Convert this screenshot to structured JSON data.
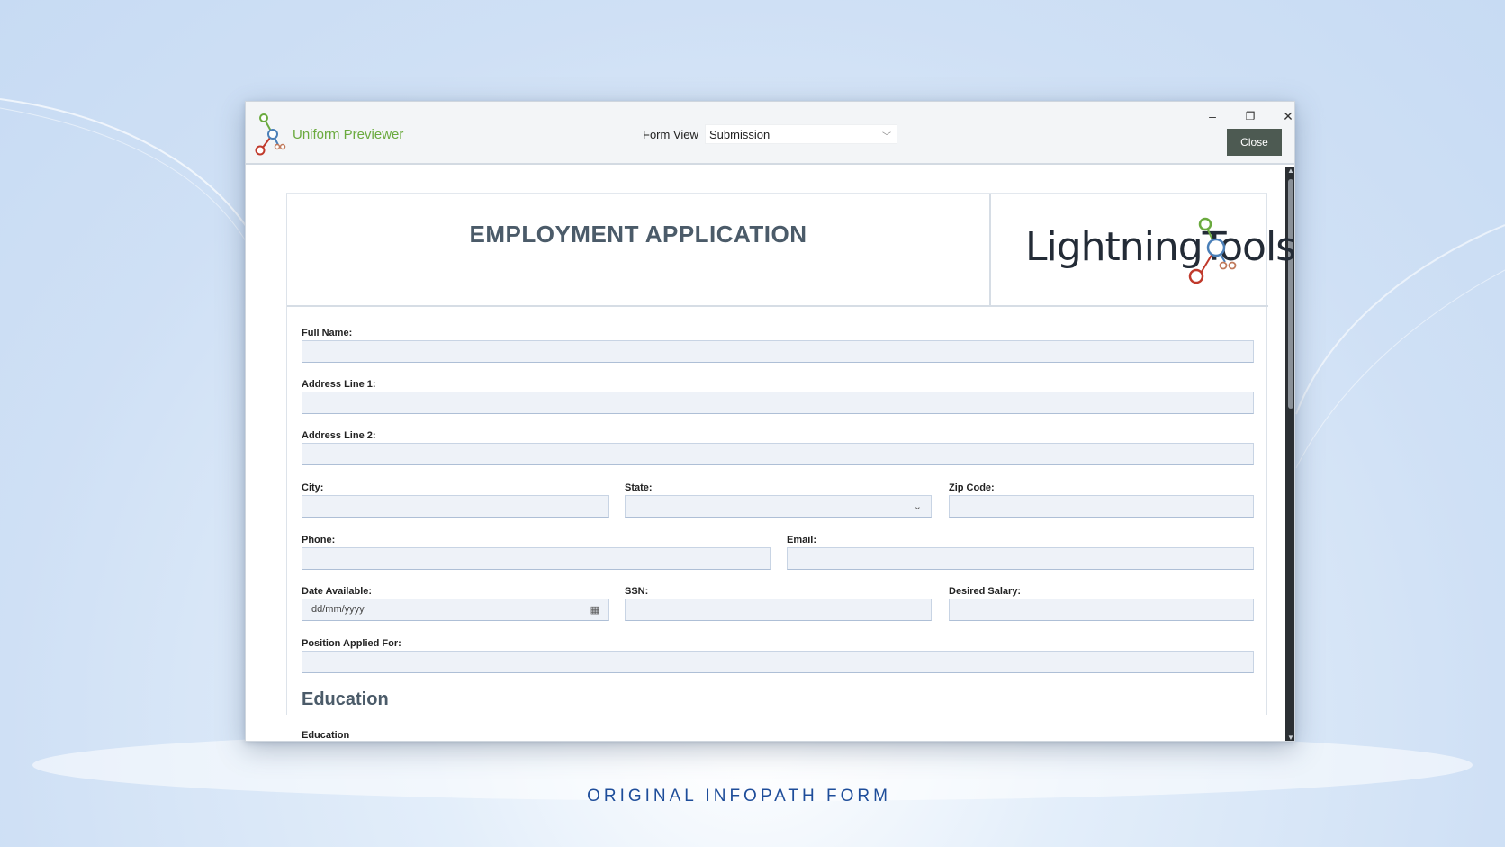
{
  "window": {
    "app_title": "Uniform Previewer",
    "form_view_label": "Form View",
    "form_view_value": "Submission",
    "close_label": "Close",
    "minimize_glyph": "–",
    "restore_glyph": "❐",
    "close_glyph": "✕"
  },
  "form": {
    "title": "EMPLOYMENT APPLICATION",
    "brand": "LightningTools",
    "fields": {
      "full_name": "Full Name:",
      "address1": "Address Line 1:",
      "address2": "Address Line 2:",
      "city": "City:",
      "state": "State:",
      "zip": "Zip Code:",
      "phone": "Phone:",
      "email": "Email:",
      "date_available": "Date Available:",
      "date_placeholder": "dd/mm/yyyy",
      "ssn": "SSN:",
      "salary": "Desired Salary:",
      "position": "Position Applied For:"
    },
    "education_section": "Education",
    "education_label": "Education"
  },
  "caption": "ORIGINAL INFOPATH FORM",
  "colors": {
    "app_title": "#6aaa3e",
    "close_button": "#4d5a52",
    "caption": "#1e4d9a",
    "field_bg": "#eef2f8"
  }
}
